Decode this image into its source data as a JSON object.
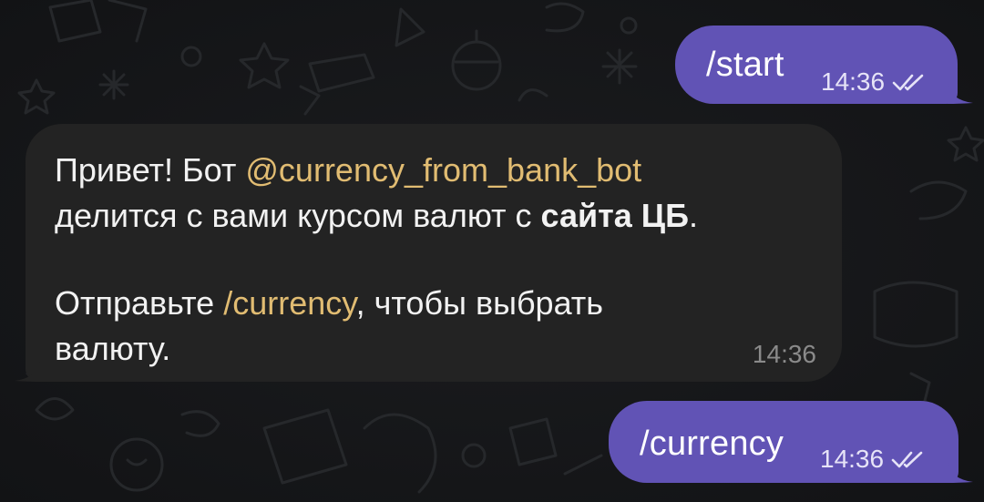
{
  "colors": {
    "outgoing_bubble": "#6153b5",
    "incoming_bubble": "#232323",
    "accent_link": "#e1bc72",
    "background": "#141517"
  },
  "messages": [
    {
      "direction": "outgoing",
      "text": "/start",
      "time": "14:36",
      "status_icon": "double-check-icon"
    },
    {
      "direction": "incoming",
      "line1_prefix": "Привет! Бот ",
      "line1_mention": "@currency_from_bank_bot",
      "line2_prefix": "делится с вами курсом валют с ",
      "line2_bold": "сайта ЦБ",
      "line2_suffix": ".",
      "line3_prefix": "Отправьте ",
      "line3_command": "/currency",
      "line3_suffix": ", чтобы выбрать",
      "line4": "валюту.",
      "time": "14:36"
    },
    {
      "direction": "outgoing",
      "text": "/currency",
      "time": "14:36",
      "status_icon": "double-check-icon"
    }
  ]
}
